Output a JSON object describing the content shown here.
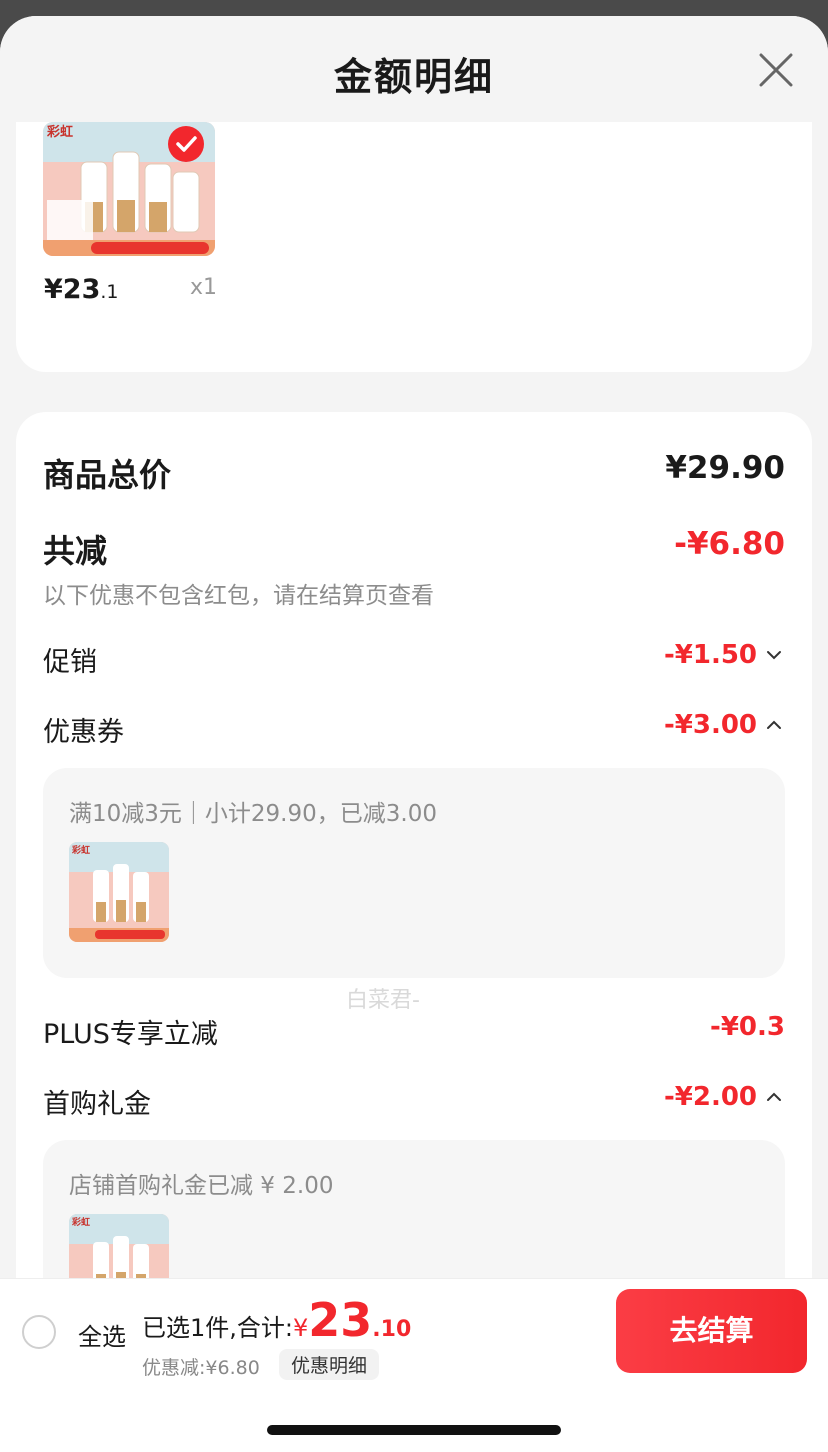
{
  "header": {
    "title": "金额明细",
    "close_icon": "close-icon"
  },
  "product": {
    "price_int": "¥23",
    "price_dec": ".1",
    "qty": "x1",
    "thumb_icon": "product-thumbnail",
    "selected": true
  },
  "breakdown": {
    "total_label": "商品总价",
    "total_value": "¥29.90",
    "reduce_label": "共减",
    "reduce_value": "-¥6.80",
    "reduce_note": "以下优惠不包含红包，请在结算页查看",
    "promo_label": "促销",
    "promo_value": "-¥1.50",
    "coupon_label": "优惠券",
    "coupon_value": "-¥3.00",
    "coupon_detail": "满10减3元｜小计29.90，已减3.00",
    "plus_label": "PLUS专享立减",
    "plus_value": "-¥0.3",
    "first_label": "首购礼金",
    "first_value": "-¥2.00",
    "first_detail": "店铺首购礼金已减 ¥ 2.00",
    "watermark": "白菜君-"
  },
  "bottom": {
    "select_all": "全选",
    "summary_text": "已选1件,合计:",
    "currency": "¥",
    "amount_int": "23",
    "amount_dec": ".10",
    "discount_text": "优惠减:¥6.80",
    "detail_link": "优惠明细",
    "checkout_label": "去结算"
  },
  "colors": {
    "accent": "#f2272d",
    "text": "#1a1a1a",
    "muted": "#8c8c8c"
  }
}
